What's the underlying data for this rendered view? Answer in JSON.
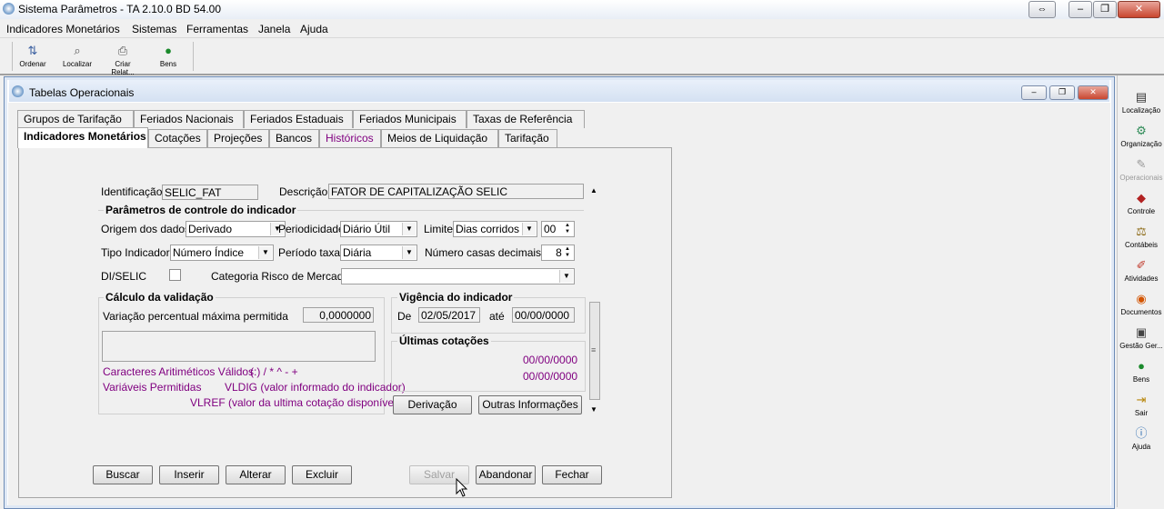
{
  "window": {
    "title": "Sistema Parâmetros -  TA 2.10.0 BD 54.00"
  },
  "menu": [
    "Indicadores Monetários",
    "Sistemas",
    "Ferramentas",
    "Janela",
    "Ajuda"
  ],
  "toolbar": [
    {
      "label": "Ordenar",
      "icon": "sort-az-icon"
    },
    {
      "label": "Localizar",
      "icon": "find-icon"
    },
    {
      "label": "Criar Relat...",
      "icon": "printer-icon"
    },
    {
      "label": "Bens",
      "icon": "money-bag-icon"
    }
  ],
  "child": {
    "title": "Tabelas Operacionais"
  },
  "tabs_row1": [
    "Grupos de Tarifação",
    "Feriados Nacionais",
    "Feriados Estaduais",
    "Feriados Municipais",
    "Taxas de Referência"
  ],
  "tabs_row2": [
    "Indicadores Monetários",
    "Cotações",
    "Projeções",
    "Bancos",
    "Históricos",
    "Meios de Liquidação",
    "Tarifação"
  ],
  "form": {
    "identificacao_label": "Identificação",
    "identificacao": "SELIC_FAT",
    "descricao_label": "Descrição",
    "descricao": "FATOR DE CAPITALIZAÇÃO SELIC",
    "params_title": "Parâmetros de controle do indicador",
    "origem_label": "Origem dos dados",
    "origem": "Derivado",
    "periodicidade_label": "Periodicidade",
    "periodicidade": "Diário Útil",
    "limite_label": "Limite",
    "limite": "Dias corridos",
    "limite_num": "00",
    "tipo_label": "Tipo Indicador",
    "tipo": "Número Índice",
    "periodo_label": "Período taxa",
    "periodo": "Diária",
    "casas_label": "Número casas decimais",
    "casas": "8",
    "diselic_label": "DI/SELIC",
    "categoria_label": "Categoria Risco de Mercado",
    "categoria": "",
    "calc_title": "Cálculo da validação",
    "variacao_label": "Variação percentual máxima permitida",
    "variacao": "0,0000000",
    "caracteres_label": "Caracteres Aritiméticos Válidos:",
    "caracteres": "( ) / * ^ - +",
    "variaveis_label": "Variáveis Permitidas",
    "vldig": "VLDIG  (valor informado do indicador)",
    "vlref": "VLREF (valor da ultima cotação disponível)",
    "vigencia_title": "Vigência do indicador",
    "de_label": "De",
    "de": "02/05/2017",
    "ate_label": "até",
    "ate": "00/00/0000",
    "ultimas_title": "Últimas cotações",
    "cot1": "00/00/0000",
    "cot2": "00/00/0000",
    "derivacao": "Derivação",
    "outras": "Outras Informações"
  },
  "buttons": {
    "buscar": "Buscar",
    "inserir": "Inserir",
    "alterar": "Alterar",
    "excluir": "Excluir",
    "salvar": "Salvar",
    "abandonar": "Abandonar",
    "fechar": "Fechar"
  },
  "rightbar": [
    {
      "label": "Localização",
      "icon": "locate-icon"
    },
    {
      "label": "Organização",
      "icon": "organization-icon"
    },
    {
      "label": "Operacionais",
      "icon": "operations-icon"
    },
    {
      "label": "Controle",
      "icon": "control-icon"
    },
    {
      "label": "Contábeis",
      "icon": "scales-icon"
    },
    {
      "label": "Atividades",
      "icon": "activities-icon"
    },
    {
      "label": "Documentos",
      "icon": "documents-icon"
    },
    {
      "label": "Gestão Ger...",
      "icon": "management-icon"
    },
    {
      "label": "Bens",
      "icon": "money-bag-icon"
    },
    {
      "label": "Sair",
      "icon": "exit-icon"
    },
    {
      "label": "Ajuda",
      "icon": "help-icon"
    }
  ]
}
